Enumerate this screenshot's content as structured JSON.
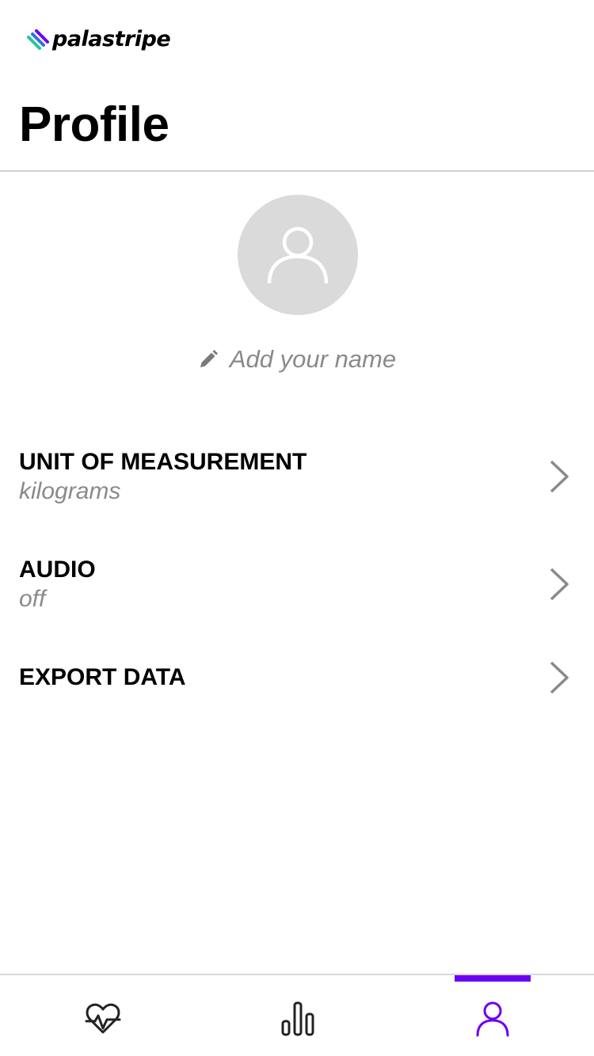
{
  "brand": {
    "name": "palastripe",
    "icon": "palastripe-stripes-logo",
    "colors": [
      "#6a00f4",
      "#2f6fe0",
      "#1fc8a0"
    ]
  },
  "header": {
    "title": "Profile"
  },
  "profile": {
    "avatar_icon": "user-avatar-icon",
    "name_icon": "pencil-icon",
    "name_placeholder": "Add your name"
  },
  "settings": [
    {
      "title": "UNIT OF MEASUREMENT",
      "value": "kilograms",
      "icon": "chevron-right-icon"
    },
    {
      "title": "AUDIO",
      "value": "off",
      "icon": "chevron-right-icon"
    },
    {
      "title": "EXPORT DATA",
      "icon": "chevron-right-icon"
    }
  ],
  "bottom_nav": {
    "tabs": [
      {
        "icon": "heart-pulse-icon",
        "active": false
      },
      {
        "icon": "bar-chart-icon",
        "active": false
      },
      {
        "icon": "person-icon",
        "active": true
      }
    ],
    "accent_color": "#6a00f4"
  }
}
